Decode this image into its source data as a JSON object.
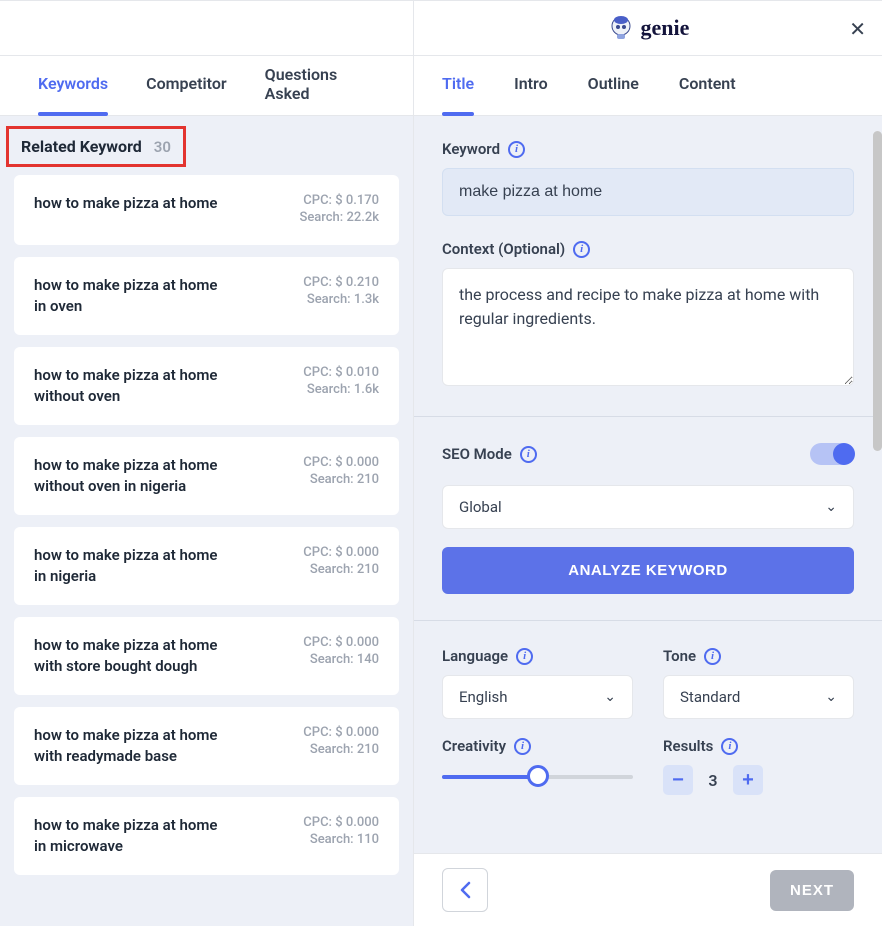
{
  "brand": {
    "name": "genie"
  },
  "leftTabs": [
    {
      "label": "Keywords",
      "active": true
    },
    {
      "label": "Competitor",
      "active": false
    },
    {
      "label": "Questions Asked",
      "active": false
    }
  ],
  "rightTabs": [
    {
      "label": "Title",
      "active": true
    },
    {
      "label": "Intro",
      "active": false
    },
    {
      "label": "Outline",
      "active": false
    },
    {
      "label": "Content",
      "active": false
    }
  ],
  "relatedKeywords": {
    "title": "Related Keyword",
    "count": "30",
    "cpc_label": "CPC: $",
    "search_label": "Search:",
    "items": [
      {
        "text": "how to make pizza at home",
        "cpc": "0.170",
        "search": "22.2k"
      },
      {
        "text": "how to make pizza at home in oven",
        "cpc": "0.210",
        "search": "1.3k"
      },
      {
        "text": "how to make pizza at home without oven",
        "cpc": "0.010",
        "search": "1.6k"
      },
      {
        "text": "how to make pizza at home without oven in nigeria",
        "cpc": "0.000",
        "search": "210"
      },
      {
        "text": "how to make pizza at home in nigeria",
        "cpc": "0.000",
        "search": "210"
      },
      {
        "text": "how to make pizza at home with store bought dough",
        "cpc": "0.000",
        "search": "140"
      },
      {
        "text": "how to make pizza at home with readymade base",
        "cpc": "0.000",
        "search": "210"
      },
      {
        "text": "how to make pizza at home in microwave",
        "cpc": "0.000",
        "search": "110"
      }
    ]
  },
  "form": {
    "keyword_label": "Keyword",
    "keyword_value": "make pizza at home",
    "context_label": "Context (Optional)",
    "context_value": "the process and recipe to make pizza at home with regular ingredients.",
    "seo_label": "SEO Mode",
    "seo_on": true,
    "region_value": "Global",
    "analyze_label": "ANALYZE KEYWORD",
    "language_label": "Language",
    "language_value": "English",
    "tone_label": "Tone",
    "tone_value": "Standard",
    "creativity_label": "Creativity",
    "results_label": "Results",
    "results_value": "3"
  },
  "footer": {
    "next_label": "NEXT"
  }
}
